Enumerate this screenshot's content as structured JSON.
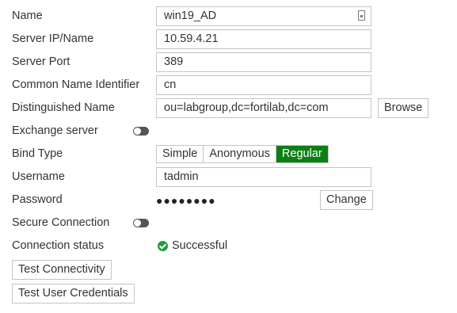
{
  "form": {
    "name": {
      "label": "Name",
      "value": "win19_AD"
    },
    "server_ip": {
      "label": "Server IP/Name",
      "value": "10.59.4.21"
    },
    "server_port": {
      "label": "Server Port",
      "value": "389"
    },
    "cn_identifier": {
      "label": "Common Name Identifier",
      "value": "cn"
    },
    "dn": {
      "label": "Distinguished Name",
      "value": "ou=labgroup,dc=fortilab,dc=com",
      "browse_label": "Browse"
    },
    "exchange": {
      "label": "Exchange server",
      "enabled": false
    },
    "bind_type": {
      "label": "Bind Type",
      "options": [
        "Simple",
        "Anonymous",
        "Regular"
      ],
      "selected": "Regular"
    },
    "username": {
      "label": "Username",
      "value": "tadmin"
    },
    "password": {
      "label": "Password",
      "masked": "●●●●●●●●",
      "change_label": "Change"
    },
    "secure": {
      "label": "Secure Connection",
      "enabled": false
    },
    "connection": {
      "label": "Connection status",
      "status": "Successful"
    },
    "test_connectivity_label": "Test Connectivity",
    "test_credentials_label": "Test User Credentials"
  },
  "colors": {
    "active_segment": "#0d7e14",
    "success_icon": "#1e9b3c",
    "toggle_off": "#555555"
  },
  "icons": {
    "name_field": "lock-icon",
    "status": "check-circle-icon"
  }
}
